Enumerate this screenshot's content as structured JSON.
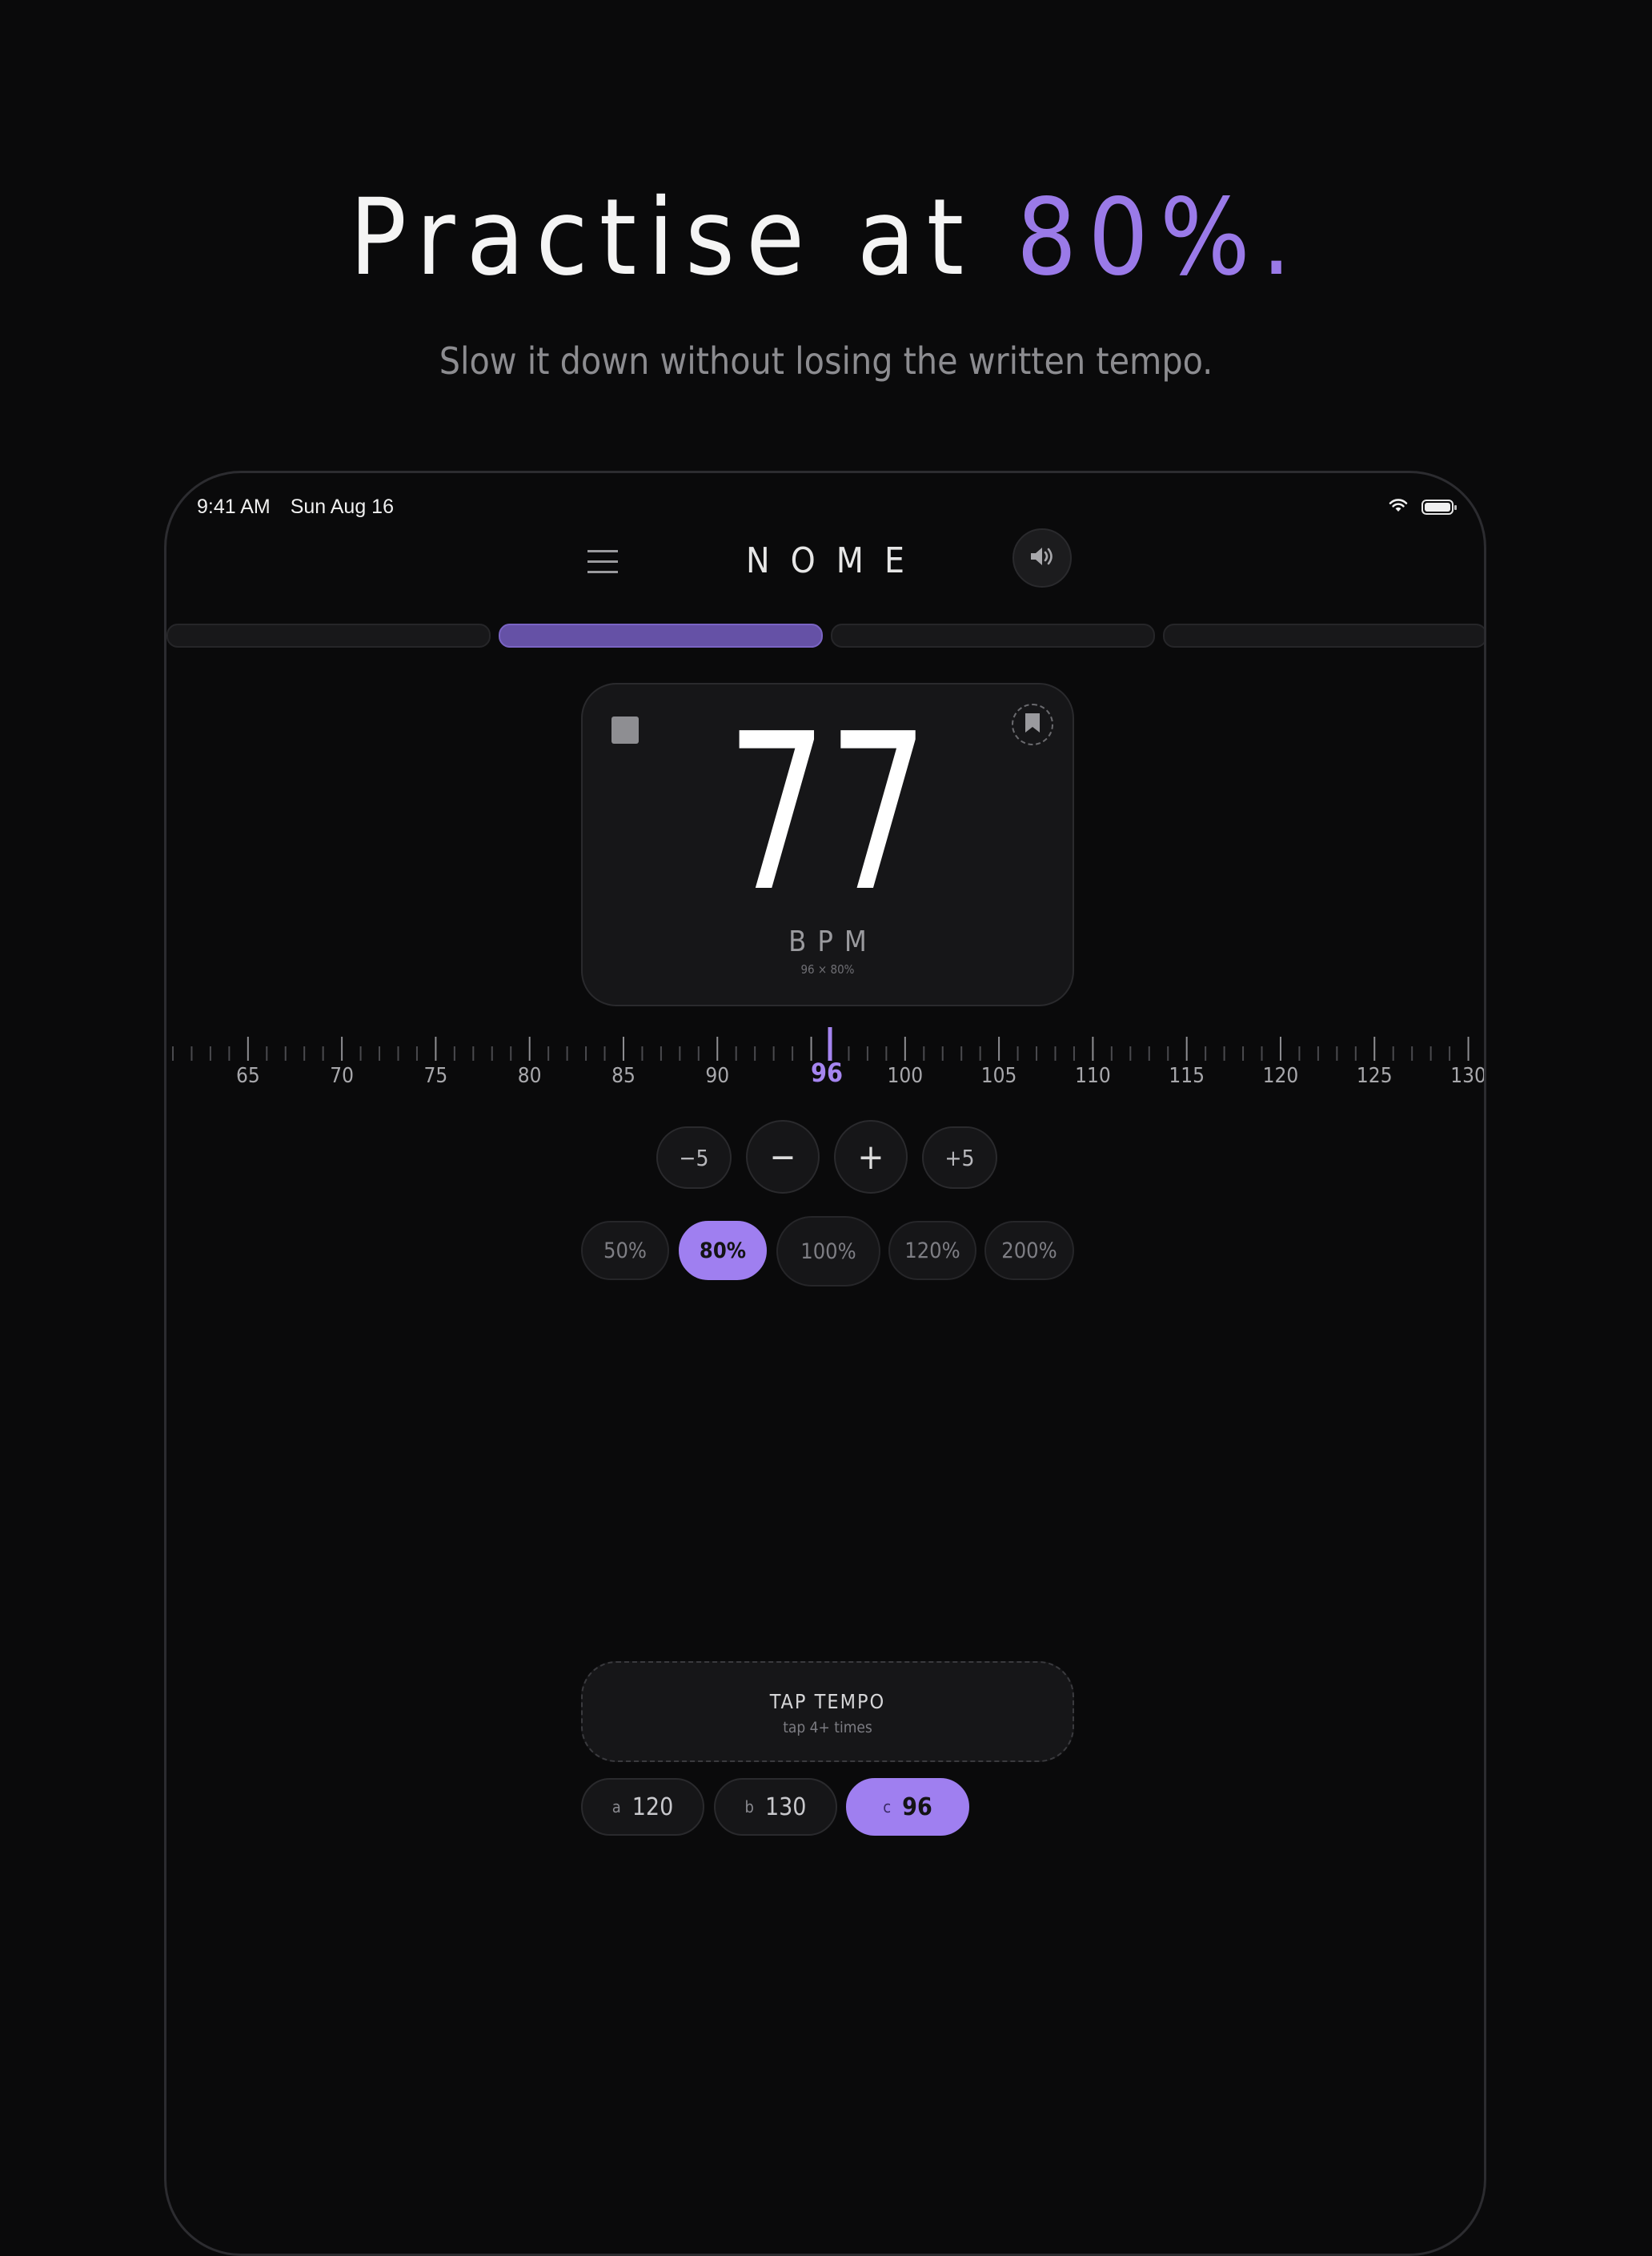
{
  "hero": {
    "title_prefix": "Practise at ",
    "title_accent": "80%.",
    "subtitle": "Slow it down without losing the written tempo."
  },
  "status_bar": {
    "time": "9:41 AM",
    "date": "Sun Aug 16",
    "icons": [
      "wifi-icon",
      "battery-icon"
    ]
  },
  "app": {
    "title": "NOME",
    "menu_icon": "hamburger-icon",
    "sound_icon": "speaker-icon"
  },
  "tabs": {
    "count": 4,
    "active_index": 1
  },
  "bpm_card": {
    "value": "77",
    "label": "BPM",
    "formula": "96 × 80%",
    "stop_icon": "stop-icon",
    "bookmark_icon": "bookmark-icon"
  },
  "ruler": {
    "min": 61,
    "max": 131,
    "labels": [
      "65",
      "70",
      "75",
      "80",
      "85",
      "90",
      "100",
      "105",
      "110",
      "115",
      "120",
      "125",
      "130"
    ],
    "current": "96"
  },
  "steppers": {
    "minus5": "−5",
    "minus": "−",
    "plus": "+",
    "plus5": "+5"
  },
  "percent_options": [
    {
      "label": "50%",
      "active": false
    },
    {
      "label": "80%",
      "active": true
    },
    {
      "label": "100%",
      "active": false
    },
    {
      "label": "120%",
      "active": false
    },
    {
      "label": "200%",
      "active": false
    }
  ],
  "tap_tempo": {
    "title": "TAP TEMPO",
    "hint": "tap 4+ times"
  },
  "presets": [
    {
      "slot": "a",
      "value": "120",
      "active": false
    },
    {
      "slot": "b",
      "value": "130",
      "active": false
    },
    {
      "slot": "c",
      "value": "96",
      "active": true
    }
  ],
  "colors": {
    "accent": "#9f7ff0",
    "background": "#0a0a0b",
    "card": "#161618"
  }
}
